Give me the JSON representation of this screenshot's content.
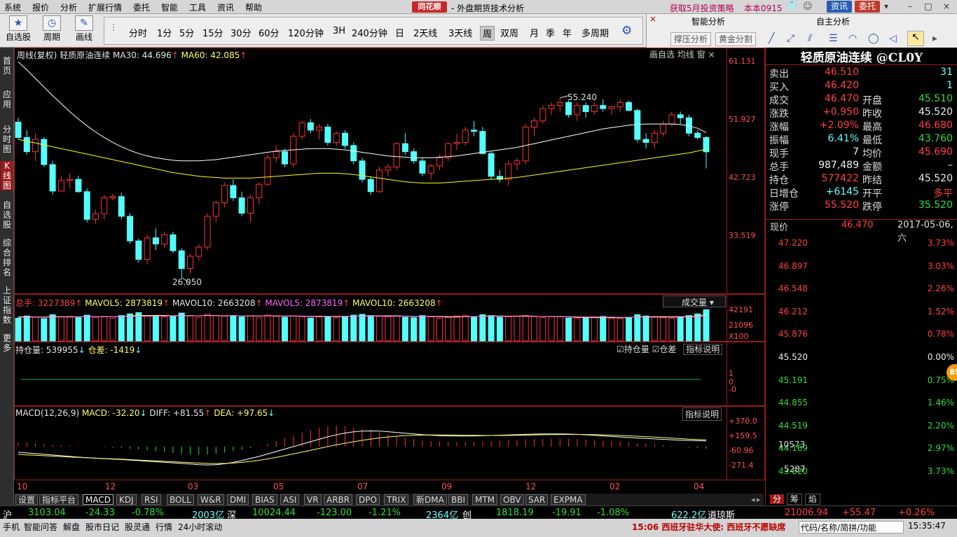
{
  "menu": [
    "系统",
    "报价",
    "分析",
    "扩展行情",
    "委托",
    "智能",
    "工具",
    "资讯",
    "帮助"
  ],
  "logo": "同花顺",
  "window_title": "- 外盘期货技术分析",
  "promo": "获取5月投资策略",
  "version": "本本0915",
  "top_btn_news": "资讯",
  "top_btn_trade": "委托",
  "win_controls": [
    "–",
    "□",
    "×"
  ],
  "toolbar": {
    "btn_watch": "自选股",
    "btn_period": "周期",
    "btn_draw": "画线",
    "periods": [
      "分时",
      "1分",
      "5分",
      "15分",
      "30分",
      "60分",
      "120分钟",
      "3H",
      "240分钟",
      "日",
      "2天线",
      "3天线",
      "周",
      "双周",
      "月",
      "季",
      "年",
      "多周期"
    ],
    "selected_period": "周"
  },
  "smart_panel": {
    "title1": "智能分析",
    "title2": "自主分析",
    "btn1": "撑压分析",
    "btn2": "黄金分割",
    "close": "×"
  },
  "sidenav": [
    "首页",
    "应用",
    "分时图",
    "K线图",
    "自选股",
    "综合排名",
    "上证指数",
    "更多"
  ],
  "kline": {
    "header_name": "周线(复权)",
    "instrument": "轻质原油连续",
    "ma30": "MA30: 44.696",
    "ma60": "MA60: 42.085",
    "tabs": [
      "画自选",
      "均线",
      "窗"
    ],
    "y_ticks": [
      "61.131",
      "51.927",
      "42.723",
      "33.519"
    ],
    "high_label": "55.240",
    "low_label": "26.050"
  },
  "volume": {
    "total": "总手: 3227389",
    "mavol5": "MAVOL5: 2873819",
    "mavol10": "MAVOL10: 2663208",
    "mavol5b": "MAVOL5: 2873819",
    "mavol10b": "MAVOL10: 2663208",
    "dropdown": "成交量",
    "y_ticks": [
      "42191",
      "21096",
      "X100"
    ]
  },
  "oi": {
    "label": "持仓量: 539955",
    "diff": "仓差: -1419",
    "cb1": "持仓量",
    "cb2": "仓差",
    "explain": "指标说明",
    "y_ticks": [
      "1",
      "0",
      "-0"
    ]
  },
  "macd": {
    "label": "MACD(12,26,9)",
    "macd": "MACD: -32.20",
    "diff": "DIFF: +81.55",
    "dea": "DEA: +97.65",
    "explain": "指标说明",
    "y_ticks": [
      "+370.0",
      "+159.5",
      "-60.96",
      "-271.4"
    ]
  },
  "x_ticks": [
    "10",
    "12",
    "03",
    "05",
    "07",
    "09",
    "12",
    "02",
    "04"
  ],
  "bottom_tabs": [
    "设置",
    "指标平台",
    "MACD",
    "KDJ",
    "RSI",
    "BOLL",
    "W&R",
    "DMI",
    "BIAS",
    "ASI",
    "VR",
    "ARBR",
    "DPO",
    "TRIX",
    "新DMA",
    "BBI",
    "MTM",
    "OBV",
    "SAR",
    "EXPMA"
  ],
  "bottom_tab_selected": "MACD",
  "quote": {
    "title": "轻质原油连续 @CL0Y",
    "rows": [
      {
        "l1": "卖出",
        "v1": "46.510",
        "l2": "",
        "v2": "31"
      },
      {
        "l1": "买入",
        "v1": "46.420",
        "l2": "",
        "v2": "1"
      },
      {
        "l1": "成交",
        "v1": "46.470",
        "l2": "开盘",
        "v2": "45.510"
      },
      {
        "l1": "涨跌",
        "v1": "+0.950",
        "l2": "昨收",
        "v2": "45.520"
      },
      {
        "l1": "涨幅",
        "v1": "+2.09%",
        "l2": "最高",
        "v2": "46.680"
      },
      {
        "l1": "振幅",
        "v1": "6.41%",
        "l2": "最低",
        "v2": "43.760"
      },
      {
        "l1": "现手",
        "v1": "7",
        "l2": "均价",
        "v2": "45.690"
      },
      {
        "l1": "总手",
        "v1": "987,489",
        "l2": "金额",
        "v2": "–"
      },
      {
        "l1": "持仓",
        "v1": "577422",
        "l2": "昨结",
        "v2": "45.520"
      },
      {
        "l1": "日增仓",
        "v1": "+6145",
        "l2": "开平",
        "v2": "多平"
      },
      {
        "l1": "涨停",
        "v1": "55.520",
        "l2": "跌停",
        "v2": "35.520"
      }
    ]
  },
  "mini": {
    "price_label": "现价",
    "price": "46.470",
    "date": "2017-05-06,六",
    "left_ticks": [
      "47.220",
      "46.897",
      "46.548",
      "46.212",
      "45.876",
      "45.520",
      "45.191",
      "44.855",
      "44.519",
      "44.169",
      "43.820"
    ],
    "right_ticks": [
      "3.73%",
      "3.03%",
      "2.26%",
      "1.52%",
      "0.78%",
      "0.00%",
      "0.75%",
      "1.46%",
      "2.20%",
      "2.97%",
      "3.73%"
    ],
    "vol_ticks": [
      "10573",
      "5287"
    ],
    "tabs": [
      "分",
      "筹",
      "焰"
    ],
    "badge": "85"
  },
  "market": [
    {
      "name": "沪",
      "price": "3103.04",
      "chg": "-24.33",
      "pct": "-0.78%",
      "amt": "2003亿"
    },
    {
      "name": "深",
      "price": "10024.44",
      "chg": "-123.00",
      "pct": "-1.21%",
      "amt": "2364亿"
    },
    {
      "name": "创",
      "price": "1818.19",
      "chg": "-19.91",
      "pct": "-1.08%",
      "amt": "622.2亿"
    },
    {
      "name": "道琼斯",
      "price": "21006.94",
      "chg": "+55.47",
      "pct": "+0.26%",
      "amt": ""
    }
  ],
  "status": {
    "items": [
      "手机",
      "智能问答",
      "解盘",
      "股市日记",
      "股灵通",
      "行情",
      "24小时滚动"
    ],
    "news": "15:06 西班牙驻华大使: 西班牙不愿缺席",
    "search": "代码/名称/简拼/功能",
    "time": "15:35:47"
  },
  "colors": {
    "up": "#ff3232",
    "down": "#54ffff",
    "ma30": "#ffffff",
    "ma60": "#ffff00",
    "pane_border": "#9b1a1a"
  },
  "chart_data": {
    "type": "candlestick",
    "period": "周",
    "instrument": "轻质原油连续",
    "y_range": [
      24.5,
      61.131
    ],
    "ohlc": [
      [
        51.3,
        52.0,
        48.5,
        48.8
      ],
      [
        48.8,
        50.0,
        46.0,
        46.5
      ],
      [
        46.5,
        49.5,
        45.0,
        48.5
      ],
      [
        48.5,
        48.9,
        44.0,
        44.4
      ],
      [
        44.4,
        45.0,
        39.5,
        40.1
      ],
      [
        40.1,
        42.5,
        40.0,
        41.8
      ],
      [
        41.8,
        43.0,
        40.5,
        42.0
      ],
      [
        42.0,
        42.6,
        39.8,
        40.0
      ],
      [
        40.0,
        40.5,
        35.0,
        35.5
      ],
      [
        35.5,
        37.0,
        34.8,
        36.4
      ],
      [
        36.4,
        39.5,
        35.5,
        39.0
      ],
      [
        39.0,
        39.6,
        38.6,
        39.2
      ],
      [
        39.2,
        39.8,
        35.5,
        36.0
      ],
      [
        36.0,
        36.5,
        31.5,
        32.0
      ],
      [
        32.0,
        32.4,
        28.5,
        29.0
      ],
      [
        29.0,
        33.0,
        28.2,
        32.5
      ],
      [
        32.5,
        34.0,
        30.5,
        31.5
      ],
      [
        31.5,
        33.5,
        30.8,
        33.0
      ],
      [
        33.0,
        33.5,
        30.0,
        30.4
      ],
      [
        30.4,
        30.8,
        26.05,
        27.5
      ],
      [
        27.5,
        30.0,
        26.6,
        29.5
      ],
      [
        29.5,
        31.5,
        28.8,
        31.0
      ],
      [
        31.0,
        36.5,
        30.5,
        36.0
      ],
      [
        36.0,
        38.5,
        35.0,
        38.2
      ],
      [
        38.2,
        41.5,
        37.5,
        41.0
      ],
      [
        41.0,
        42.0,
        38.5,
        39.0
      ],
      [
        39.0,
        40.0,
        36.0,
        36.5
      ],
      [
        36.5,
        39.5,
        35.0,
        39.0
      ],
      [
        39.0,
        41.5,
        38.0,
        41.2
      ],
      [
        41.2,
        46.0,
        41.0,
        45.5
      ],
      [
        45.5,
        47.5,
        44.8,
        46.5
      ],
      [
        46.5,
        47.0,
        44.0,
        44.5
      ],
      [
        44.5,
        49.5,
        44.0,
        49.0
      ],
      [
        49.0,
        51.5,
        48.5,
        51.2
      ],
      [
        51.2,
        51.8,
        49.5,
        50.0
      ],
      [
        50.0,
        51.0,
        48.5,
        50.5
      ],
      [
        50.5,
        51.0,
        47.5,
        48.0
      ],
      [
        48.0,
        49.8,
        47.5,
        49.5
      ],
      [
        49.5,
        50.0,
        47.0,
        47.5
      ],
      [
        47.5,
        48.0,
        44.5,
        45.0
      ],
      [
        45.0,
        45.5,
        41.5,
        42.0
      ],
      [
        42.0,
        42.5,
        39.5,
        40.0
      ],
      [
        40.0,
        44.0,
        39.8,
        43.5
      ],
      [
        43.5,
        44.5,
        42.5,
        44.0
      ],
      [
        44.0,
        48.0,
        43.5,
        47.8
      ],
      [
        47.8,
        49.5,
        46.0,
        46.5
      ],
      [
        46.5,
        47.0,
        44.5,
        45.0
      ],
      [
        45.0,
        45.5,
        42.5,
        43.0
      ],
      [
        43.0,
        44.5,
        42.0,
        44.2
      ],
      [
        44.2,
        46.0,
        43.5,
        45.5
      ],
      [
        45.5,
        48.0,
        45.0,
        47.8
      ],
      [
        47.8,
        49.5,
        46.8,
        48.0
      ],
      [
        48.0,
        50.5,
        47.5,
        50.0
      ],
      [
        50.0,
        51.5,
        49.0,
        49.8
      ],
      [
        49.8,
        50.5,
        46.0,
        46.2
      ],
      [
        46.2,
        46.5,
        42.0,
        42.5
      ],
      [
        42.5,
        43.5,
        41.5,
        42.0
      ],
      [
        42.0,
        45.0,
        41.0,
        44.5
      ],
      [
        44.5,
        45.5,
        43.5,
        45.0
      ],
      [
        45.0,
        51.0,
        44.5,
        50.5
      ],
      [
        50.5,
        52.0,
        49.0,
        51.5
      ],
      [
        51.5,
        54.0,
        51.0,
        53.5
      ],
      [
        53.5,
        54.5,
        52.5,
        54.0
      ],
      [
        54.0,
        55.24,
        53.0,
        54.5
      ],
      [
        54.5,
        54.8,
        52.0,
        52.5
      ],
      [
        52.5,
        54.5,
        51.5,
        54.0
      ],
      [
        54.0,
        54.5,
        52.0,
        53.0
      ],
      [
        53.0,
        54.5,
        52.5,
        54.0
      ],
      [
        54.0,
        55.0,
        53.0,
        53.5
      ],
      [
        53.5,
        54.0,
        52.5,
        53.8
      ],
      [
        53.8,
        55.0,
        53.0,
        54.5
      ],
      [
        54.5,
        54.8,
        53.0,
        53.2
      ],
      [
        53.2,
        53.5,
        48.0,
        48.5
      ],
      [
        48.5,
        49.5,
        47.0,
        48.0
      ],
      [
        48.0,
        50.0,
        47.0,
        49.5
      ],
      [
        49.5,
        51.5,
        49.0,
        51.0
      ],
      [
        51.0,
        53.0,
        50.5,
        52.5
      ],
      [
        52.5,
        53.0,
        51.0,
        52.0
      ],
      [
        52.0,
        52.5,
        49.0,
        49.5
      ],
      [
        49.5,
        50.0,
        48.5,
        48.8
      ],
      [
        48.8,
        49.0,
        43.76,
        46.47
      ]
    ],
    "ma30": [
      61.1,
      59.8,
      58.4,
      57.0,
      55.6,
      54.3,
      53.0,
      51.8,
      50.7,
      49.7,
      48.8,
      48.0,
      47.3,
      46.7,
      46.2,
      45.8,
      45.5,
      45.3,
      45.1,
      45.0,
      45.0,
      45.0,
      45.1,
      45.2,
      45.4,
      45.6,
      45.8,
      46.0,
      46.2,
      46.4,
      46.6,
      46.7,
      46.8,
      46.9,
      47.0,
      47.0,
      47.0,
      46.9,
      46.8,
      46.6,
      46.4,
      46.2,
      46.0,
      45.8,
      45.7,
      45.6,
      45.5,
      45.5,
      45.5,
      45.6,
      45.7,
      45.8,
      46.0,
      46.2,
      46.4,
      46.6,
      46.8,
      47.0,
      47.2,
      47.5,
      47.8,
      48.1,
      48.4,
      48.7,
      49.0,
      49.3,
      49.6,
      49.9,
      50.2,
      50.4,
      50.6,
      50.8,
      50.9,
      51.0,
      51.0,
      51.0,
      51.0,
      50.9,
      50.7,
      50.3,
      49.6
    ],
    "ma60": [
      48.5,
      48.2,
      47.9,
      47.6,
      47.3,
      47.0,
      46.7,
      46.4,
      46.1,
      45.8,
      45.5,
      45.2,
      44.9,
      44.6,
      44.3,
      44.0,
      43.7,
      43.4,
      43.1,
      42.9,
      42.7,
      42.5,
      42.4,
      42.3,
      42.2,
      42.2,
      42.2,
      42.2,
      42.3,
      42.4,
      42.5,
      42.6,
      42.7,
      42.8,
      42.9,
      43.0,
      43.0,
      43.0,
      42.9,
      42.8,
      42.6,
      42.4,
      42.2,
      42.0,
      41.8,
      41.6,
      41.5,
      41.4,
      41.4,
      41.4,
      41.5,
      41.6,
      41.7,
      41.8,
      41.9,
      42.0,
      42.1,
      42.2,
      42.3,
      42.5,
      42.7,
      42.9,
      43.1,
      43.3,
      43.5,
      43.7,
      43.9,
      44.1,
      44.3,
      44.5,
      44.7,
      44.9,
      45.1,
      45.3,
      45.5,
      45.7,
      45.9,
      46.1,
      46.3,
      46.6,
      46.9
    ],
    "volume_range": [
      0,
      42191
    ],
    "volume": [
      27000,
      29500,
      28000,
      26500,
      31000,
      28500,
      29000,
      27500,
      30500,
      28000,
      29000,
      27000,
      30000,
      32000,
      33500,
      29000,
      30000,
      28500,
      29500,
      33000,
      29500,
      28000,
      31500,
      30000,
      29000,
      30000,
      28500,
      29500,
      27500,
      30500,
      29000,
      28000,
      29500,
      28500,
      27000,
      28500,
      29000,
      27500,
      29000,
      30500,
      31500,
      30000,
      29000,
      28500,
      29500,
      28000,
      27500,
      30000,
      28500,
      27000,
      28000,
      29500,
      30000,
      28500,
      31000,
      30000,
      28000,
      28500,
      29500,
      30000,
      29000,
      27500,
      28500,
      29000,
      27000,
      26500,
      28000,
      27500,
      29000,
      27000,
      26500,
      28000,
      31000,
      29500,
      28000,
      27500,
      27000,
      28500,
      30000,
      32000,
      37000
    ],
    "mavol5": [
      28500,
      28600,
      28400,
      28300,
      28800,
      28700,
      28600,
      28500,
      28900,
      28600,
      28700,
      28500,
      28900,
      29400,
      30200,
      30100,
      30300,
      30200,
      29800,
      30100,
      30000,
      29800,
      30200,
      30000,
      29800,
      30000,
      29700,
      29600,
      29400,
      29800,
      29600,
      29300,
      29500,
      29300,
      28900,
      28900,
      28900,
      28700,
      28900,
      29100,
      29600,
      29600,
      29700,
      29800,
      29800,
      29400,
      28900,
      29100,
      28900,
      28600,
      28200,
      28400,
      28600,
      28600,
      29100,
      29600,
      29500,
      29400,
      29300,
      29700,
      29300,
      28900,
      28900,
      28800,
      28400,
      27900,
      27800,
      27600,
      27600,
      27500,
      27500,
      27600,
      28300,
      28600,
      28700,
      28700,
      28800,
      28700,
      28700,
      29400,
      30900
    ],
    "mavol10": [
      28000,
      28100,
      28100,
      28000,
      28300,
      28300,
      28400,
      28400,
      28600,
      28600,
      28600,
      28600,
      28700,
      28900,
      29200,
      29400,
      29500,
      29500,
      29600,
      29800,
      29800,
      29800,
      29900,
      29900,
      29800,
      29900,
      29800,
      29700,
      29600,
      29700,
      29600,
      29500,
      29500,
      29400,
      29300,
      29300,
      29200,
      29100,
      29100,
      29200,
      29300,
      29300,
      29300,
      29300,
      29300,
      29300,
      29200,
      29200,
      29100,
      29000,
      28900,
      28900,
      28900,
      28900,
      29000,
      29100,
      29100,
      29100,
      29000,
      29100,
      29000,
      28900,
      28900,
      28800,
      28700,
      28500,
      28400,
      28300,
      28200,
      28100,
      28000,
      28000,
      28100,
      28100,
      28100,
      28100,
      28100,
      28100,
      28200,
      28500,
      29000
    ],
    "oi_line": 0,
    "macd_range": [
      -271.4,
      370.0
    ],
    "macd_hist": [
      60,
      55,
      48,
      40,
      30,
      22,
      15,
      8,
      2,
      -4,
      -10,
      -16,
      -22,
      -30,
      -40,
      -52,
      -65,
      -78,
      -90,
      -100,
      -110,
      -118,
      -112,
      -100,
      -85,
      -65,
      -45,
      -20,
      10,
      40,
      80,
      120,
      160,
      200,
      240,
      270,
      290,
      300,
      290,
      270,
      250,
      225,
      200,
      175,
      150,
      128,
      108,
      92,
      80,
      72,
      68,
      66,
      66,
      68,
      72,
      78,
      86,
      94,
      100,
      104,
      108,
      110,
      112,
      112,
      110,
      106,
      100,
      94,
      86,
      78,
      70,
      62,
      52,
      42,
      32,
      22,
      12,
      2,
      -10,
      -22,
      -32
    ],
    "diff": [
      -80,
      -90,
      -100,
      -110,
      -120,
      -130,
      -140,
      -150,
      -158,
      -165,
      -172,
      -178,
      -185,
      -192,
      -200,
      -208,
      -216,
      -224,
      -232,
      -240,
      -248,
      -258,
      -262,
      -258,
      -245,
      -225,
      -200,
      -170,
      -140,
      -105,
      -70,
      -35,
      0,
      35,
      70,
      105,
      140,
      170,
      195,
      212,
      222,
      225,
      222,
      214,
      204,
      192,
      182,
      172,
      164,
      158,
      154,
      152,
      152,
      154,
      156,
      160,
      164,
      168,
      172,
      176,
      180,
      182,
      183,
      182,
      180,
      176,
      170,
      162,
      154,
      146,
      138,
      130,
      122,
      116,
      110,
      104,
      98,
      92,
      88,
      84,
      81.55
    ],
    "dea": [
      -110,
      -118,
      -124,
      -130,
      -136,
      -142,
      -148,
      -154,
      -160,
      -165,
      -170,
      -175,
      -180,
      -186,
      -192,
      -198,
      -204,
      -210,
      -216,
      -222,
      -228,
      -235,
      -240,
      -242,
      -240,
      -234,
      -225,
      -212,
      -196,
      -176,
      -154,
      -130,
      -104,
      -78,
      -52,
      -26,
      0,
      25,
      48,
      70,
      90,
      108,
      124,
      138,
      150,
      158,
      163,
      166,
      168,
      168,
      167,
      165,
      163,
      162,
      160,
      160,
      160,
      161,
      163,
      165,
      168,
      170,
      172,
      174,
      175,
      175,
      174,
      172,
      169,
      165,
      160,
      155,
      149,
      143,
      136,
      129,
      121,
      114,
      107,
      101,
      97.65
    ]
  }
}
